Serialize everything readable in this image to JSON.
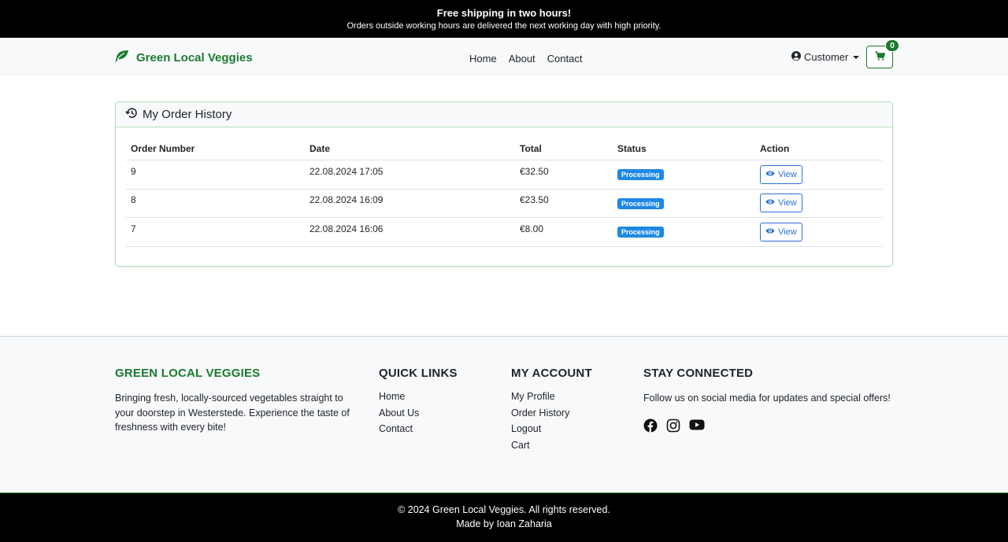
{
  "announcement": {
    "title": "Free shipping in two hours!",
    "subtitle": "Orders outside working hours are delivered the next working day with high priority."
  },
  "navbar": {
    "brand": "Green Local Veggies",
    "links": [
      "Home",
      "About",
      "Contact"
    ],
    "user_menu": "Customer",
    "cart_count": "0",
    "brand_color": "#1b7a2f"
  },
  "orders": {
    "title": "My Order History",
    "columns": [
      "Order Number",
      "Date",
      "Total",
      "Status",
      "Action"
    ],
    "rows": [
      {
        "number": "9",
        "date": "22.08.2024 17:05",
        "total": "€32.50",
        "status": "Processing",
        "action": "View"
      },
      {
        "number": "8",
        "date": "22.08.2024 16:09",
        "total": "€23.50",
        "status": "Processing",
        "action": "View"
      },
      {
        "number": "7",
        "date": "22.08.2024 16:06",
        "total": "€8.00",
        "status": "Processing",
        "action": "View"
      }
    ],
    "status_color": "#1e88e5"
  },
  "footer": {
    "about": {
      "heading": "GREEN LOCAL VEGGIES",
      "text": "Bringing fresh, locally-sourced vegetables straight to your doorstep in Westerstede. Experience the taste of freshness with every bite!"
    },
    "quick_links": {
      "heading": "QUICK LINKS",
      "items": [
        "Home",
        "About Us",
        "Contact"
      ]
    },
    "account": {
      "heading": "MY ACCOUNT",
      "items": [
        "My Profile",
        "Order History",
        "Logout",
        "Cart"
      ]
    },
    "social": {
      "heading": "STAY CONNECTED",
      "text": "Follow us on social media for updates and special offers!",
      "icons": [
        "facebook-icon",
        "instagram-icon",
        "youtube-icon"
      ]
    }
  },
  "bottom": {
    "copyright": "© 2024 Green Local Veggies. All rights reserved.",
    "credit": "Made by Ioan Zaharia"
  }
}
